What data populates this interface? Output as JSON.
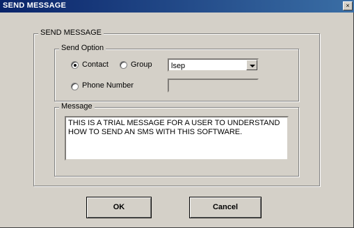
{
  "window": {
    "title": "SEND MESSAGE",
    "close_glyph": "×"
  },
  "outer_group": {
    "legend": "SEND MESSAGE"
  },
  "send_option": {
    "legend": "Send Option",
    "contact_label": "Contact",
    "group_label": "Group",
    "phone_label": "Phone Number",
    "selected_option": "Contact",
    "dropdown_value": "lsep",
    "phone_value": ""
  },
  "message": {
    "legend": "Message",
    "text": "THIS IS A TRIAL MESSAGE FOR A USER TO UNDERSTAND HOW TO SEND AN SMS WITH THIS SOFTWARE."
  },
  "buttons": {
    "ok": "OK",
    "cancel": "Cancel"
  }
}
